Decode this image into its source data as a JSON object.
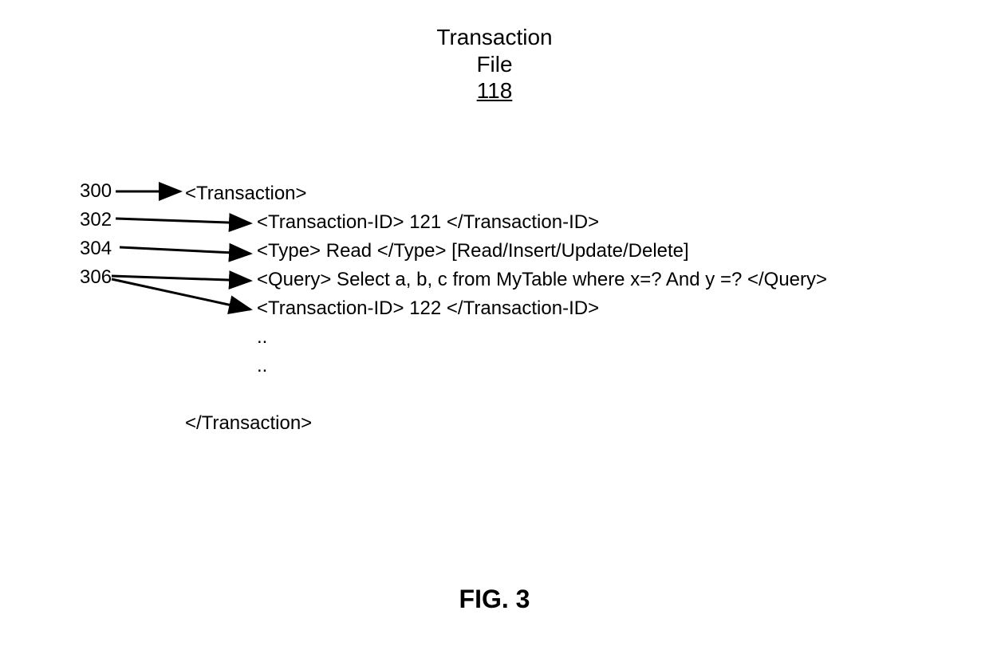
{
  "title": {
    "line1": "Transaction",
    "line2": "File",
    "line3": "118"
  },
  "labels": {
    "l0": "300",
    "l1": "302",
    "l2": "304",
    "l3": "306"
  },
  "content": {
    "line0": "<Transaction>",
    "line1": "<Transaction-ID> 121 </Transaction-ID>",
    "line2": "<Type> Read </Type> [Read/Insert/Update/Delete]",
    "line3": "<Query> Select a, b, c from MyTable where x=? And y =?  </Query>",
    "line4": "<Transaction-ID> 122 </Transaction-ID>",
    "line5": "..",
    "line6": "..",
    "line7": "</Transaction>"
  },
  "figure": "FIG. 3"
}
